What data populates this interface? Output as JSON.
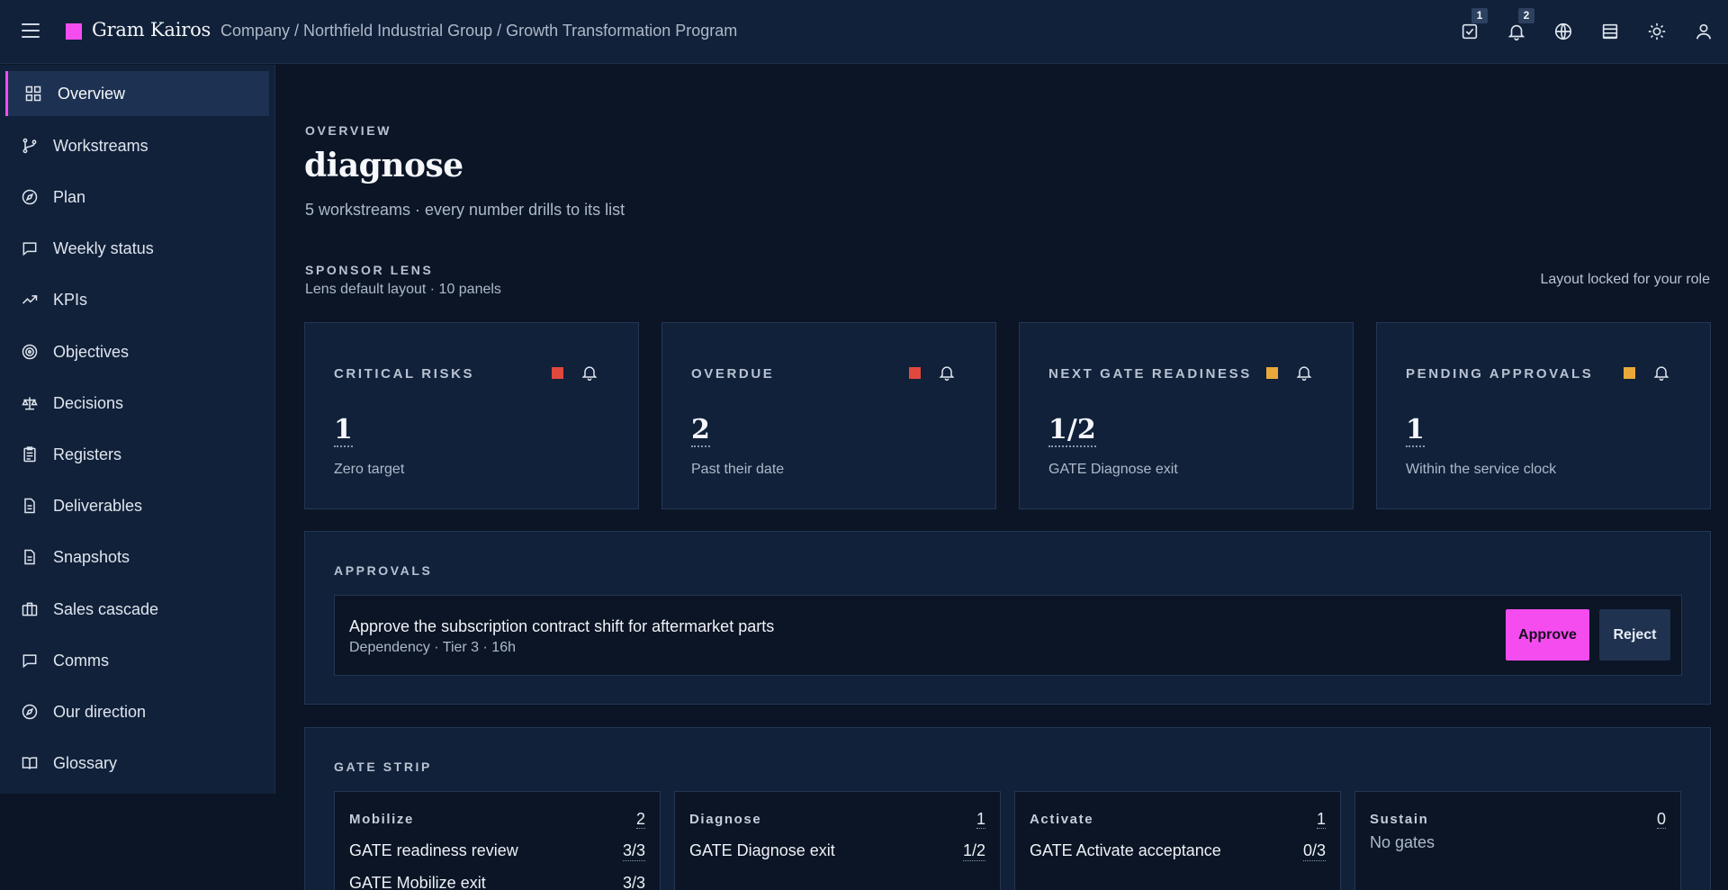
{
  "header": {
    "brand": "Gram Kairos",
    "breadcrumb": "Company / Northfield Industrial Group / Growth Transformation Program",
    "tasks_badge": "1",
    "notifications_badge": "2",
    "icons": [
      "menu-icon",
      "tasks-icon",
      "bell-icon",
      "globe-icon",
      "table-icon",
      "sun-icon",
      "user-icon"
    ],
    "brand_color": "#f54cf0"
  },
  "sidebar": {
    "items": [
      {
        "label": "Overview",
        "icon": "grid-icon",
        "active": true
      },
      {
        "label": "Workstreams",
        "icon": "branch-icon"
      },
      {
        "label": "Plan",
        "icon": "compass-icon"
      },
      {
        "label": "Weekly status",
        "icon": "chat-icon"
      },
      {
        "label": "KPIs",
        "icon": "trend-icon"
      },
      {
        "label": "Objectives",
        "icon": "target-icon"
      },
      {
        "label": "Decisions",
        "icon": "scale-icon"
      },
      {
        "label": "Registers",
        "icon": "clipboard-icon"
      },
      {
        "label": "Deliverables",
        "icon": "document-icon"
      },
      {
        "label": "Snapshots",
        "icon": "document-icon"
      },
      {
        "label": "Sales cascade",
        "icon": "briefcase-icon"
      },
      {
        "label": "Comms",
        "icon": "chat-icon"
      },
      {
        "label": "Our direction",
        "icon": "compass-icon"
      },
      {
        "label": "Glossary",
        "icon": "book-icon"
      }
    ]
  },
  "page": {
    "eyebrow": "OVERVIEW",
    "title": "diagnose",
    "subtitle": "5 workstreams · every number drills to its list"
  },
  "lens": {
    "eyebrow": "SPONSOR LENS",
    "subtitle": "Lens default layout · 10 panels",
    "lock_note": "Layout locked for your role"
  },
  "cards": [
    {
      "title": "CRITICAL RISKS",
      "value": "1",
      "caption": "Zero target",
      "status_color": "#e0483e"
    },
    {
      "title": "OVERDUE",
      "value": "2",
      "caption": "Past their date",
      "status_color": "#e0483e"
    },
    {
      "title": "NEXT GATE READINESS",
      "value": "1/2",
      "caption": "GATE Diagnose exit",
      "status_color": "#e9a93a"
    },
    {
      "title": "PENDING APPROVALS",
      "value": "1",
      "caption": "Within the service clock",
      "status_color": "#e9a93a"
    }
  ],
  "approvals": {
    "eyebrow": "APPROVALS",
    "item": {
      "title": "Approve the subscription contract shift for aftermarket parts",
      "meta": "Dependency · Tier 3 · 16h",
      "approve_label": "Approve",
      "reject_label": "Reject"
    }
  },
  "gate_strip": {
    "eyebrow": "GATE STRIP",
    "columns": [
      {
        "name": "Mobilize",
        "count": "2",
        "rows": [
          {
            "label": "GATE readiness review",
            "score": "3/3"
          },
          {
            "label": "GATE Mobilize exit",
            "score": "3/3"
          }
        ]
      },
      {
        "name": "Diagnose",
        "count": "1",
        "rows": [
          {
            "label": "GATE Diagnose exit",
            "score": "1/2"
          }
        ]
      },
      {
        "name": "Activate",
        "count": "1",
        "rows": [
          {
            "label": "GATE Activate acceptance",
            "score": "0/3"
          }
        ]
      },
      {
        "name": "Sustain",
        "count": "0",
        "empty": "No gates",
        "rows": []
      }
    ]
  }
}
